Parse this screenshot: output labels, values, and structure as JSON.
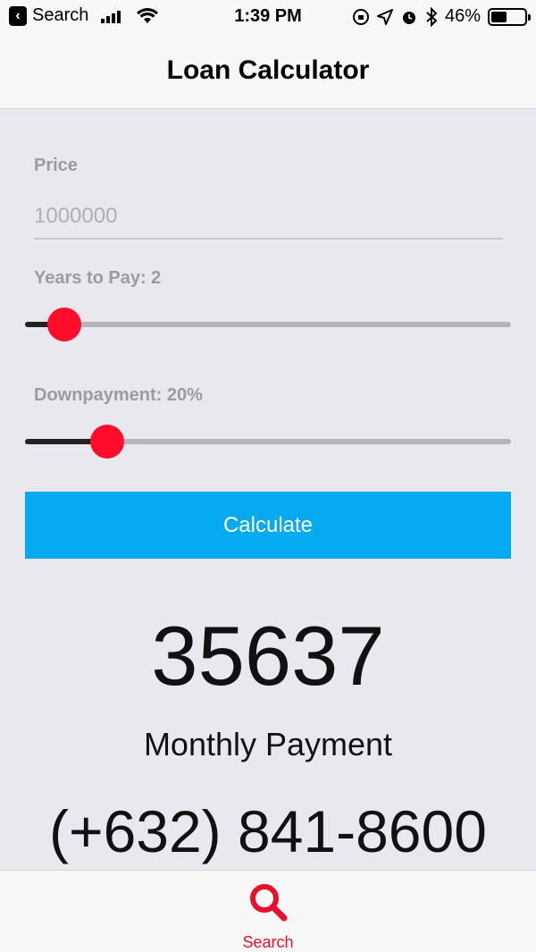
{
  "status_bar": {
    "back_label": "Search",
    "time": "1:39 PM",
    "battery": "46%",
    "battery_level": 0.46
  },
  "nav": {
    "title": "Loan Calculator"
  },
  "form": {
    "price_label": "Price",
    "price_placeholder": "1000000",
    "years_label": "Years to Pay: 2",
    "years_slider_fraction": 0.08,
    "downpayment_label": "Downpayment: 20%",
    "downpayment_slider_fraction": 0.17,
    "calculate_label": "Calculate"
  },
  "result": {
    "value": "35637",
    "label": "Monthly Payment",
    "phone": "(+632) 841-8600"
  },
  "tab_bar": {
    "items": [
      {
        "label": "Search",
        "icon": "search-icon",
        "active_color": "#e8102b"
      }
    ]
  },
  "colors": {
    "accent_button": "#05aaf0",
    "slider_thumb": "#ff0d2a",
    "tab_active": "#e8102b"
  }
}
